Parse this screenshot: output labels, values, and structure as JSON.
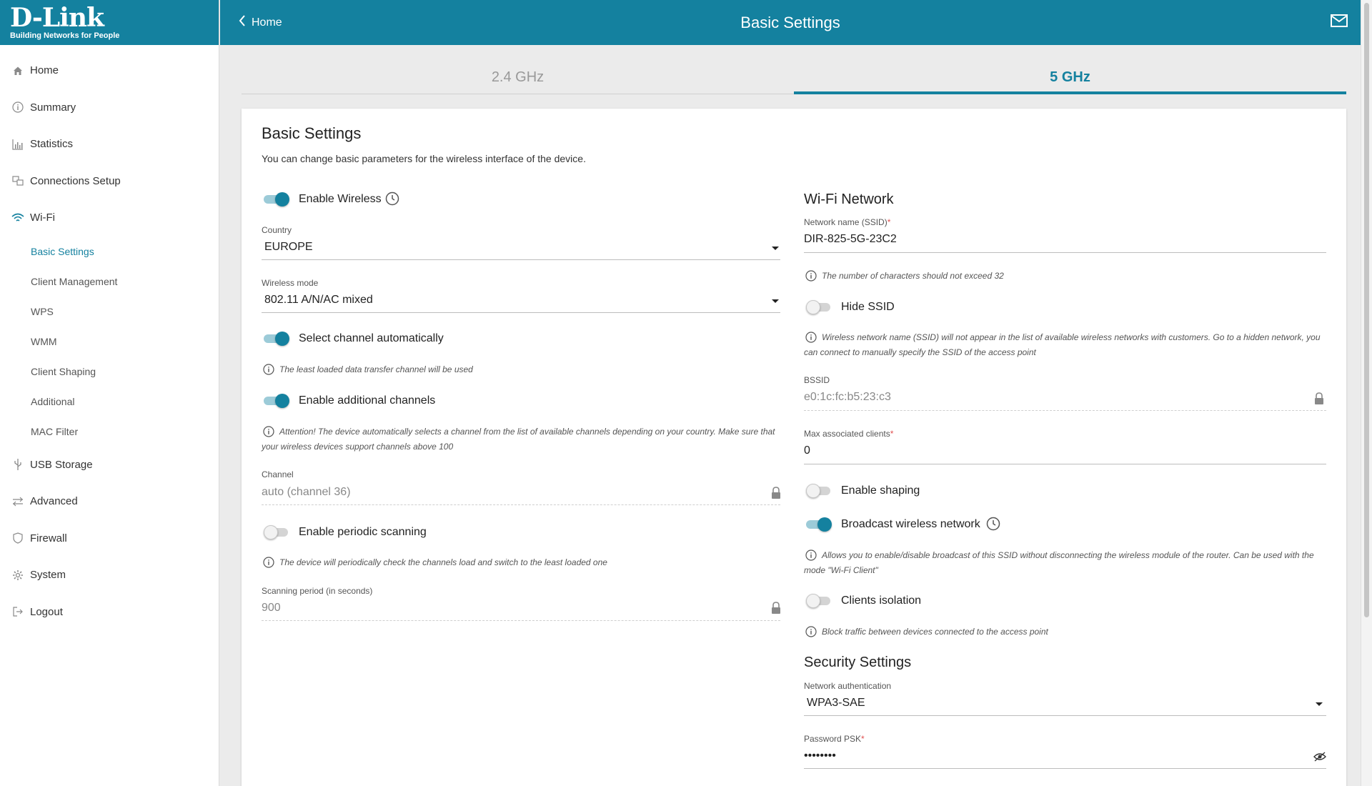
{
  "brand": {
    "logo": "D-Link",
    "tagline": "Building Networks for People"
  },
  "header": {
    "back_label": "Home",
    "title": "Basic Settings",
    "mail_icon": "mail-icon"
  },
  "sidebar": {
    "items": [
      {
        "label": "Home",
        "icon": "home-icon"
      },
      {
        "label": "Summary",
        "icon": "info-icon"
      },
      {
        "label": "Statistics",
        "icon": "chart-icon"
      },
      {
        "label": "Connections Setup",
        "icon": "connections-icon"
      },
      {
        "label": "Wi-Fi",
        "icon": "wifi-icon"
      },
      {
        "label": "USB Storage",
        "icon": "usb-icon"
      },
      {
        "label": "Advanced",
        "icon": "sliders-icon"
      },
      {
        "label": "Firewall",
        "icon": "shield-icon"
      },
      {
        "label": "System",
        "icon": "gear-icon"
      },
      {
        "label": "Logout",
        "icon": "logout-icon"
      }
    ],
    "wifi_sub": [
      "Basic Settings",
      "Client Management",
      "WPS",
      "WMM",
      "Client Shaping",
      "Additional",
      "MAC Filter"
    ]
  },
  "tabs": [
    {
      "label": "2.4 GHz"
    },
    {
      "label": "5 GHz",
      "active": true
    }
  ],
  "card": {
    "title": "Basic Settings",
    "description": "You can change basic parameters for the wireless interface of the device."
  },
  "left": {
    "enable_wireless": {
      "label": "Enable Wireless",
      "on": true
    },
    "country": {
      "label": "Country",
      "value": "EUROPE"
    },
    "wireless_mode": {
      "label": "Wireless mode",
      "value": "802.11 A/N/AC mixed"
    },
    "auto_channel": {
      "label": "Select channel automatically",
      "on": true,
      "hint": "The least loaded data transfer channel will be used"
    },
    "additional_channels": {
      "label": "Enable additional channels",
      "on": true,
      "hint_line1": "Attention! The device automatically selects a channel from the list of available channels depending on your country. Make sure that",
      "hint_line2": "your wireless devices support channels above 100"
    },
    "channel": {
      "label": "Channel",
      "value": "auto (channel 36)"
    },
    "periodic_scanning": {
      "label": "Enable periodic scanning",
      "on": false,
      "hint": "The device will periodically check the channels load and switch to the least loaded one"
    },
    "scanning_period": {
      "label": "Scanning period (in seconds)",
      "value": "900"
    }
  },
  "right": {
    "wifi_title": "Wi-Fi Network",
    "ssid": {
      "label": "Network name (SSID)",
      "required": "*",
      "value": "DIR-825-5G-23C2",
      "hint": "The number of characters should not exceed 32"
    },
    "hide_ssid": {
      "label": "Hide SSID",
      "on": false,
      "hint_line1": "Wireless network name (SSID) will not appear in the list of available wireless networks with customers. Go to a hidden network, you",
      "hint_line2": "can connect to manually specify the SSID of the access point"
    },
    "bssid": {
      "label": "BSSID",
      "value": "e0:1c:fc:b5:23:c3"
    },
    "max_clients": {
      "label": "Max associated clients",
      "required": "*",
      "value": "0"
    },
    "shaping": {
      "label": "Enable shaping",
      "on": false
    },
    "broadcast": {
      "label": "Broadcast wireless network",
      "on": true,
      "hint_line1": "Allows you to enable/disable broadcast of this SSID without disconnecting the wireless module of the router. Can be used with the",
      "hint_line2": "mode \"Wi-Fi Client\""
    },
    "isolation": {
      "label": "Clients isolation",
      "on": false,
      "hint": "Block traffic between devices connected to the access point"
    },
    "security_title": "Security Settings",
    "auth": {
      "label": "Network authentication",
      "value": "WPA3-SAE"
    },
    "psk": {
      "label": "Password PSK",
      "required": "*",
      "value": "••••••••"
    }
  },
  "colors": {
    "accent": "#14819f",
    "background": "#ebebeb",
    "card": "#ffffff"
  }
}
